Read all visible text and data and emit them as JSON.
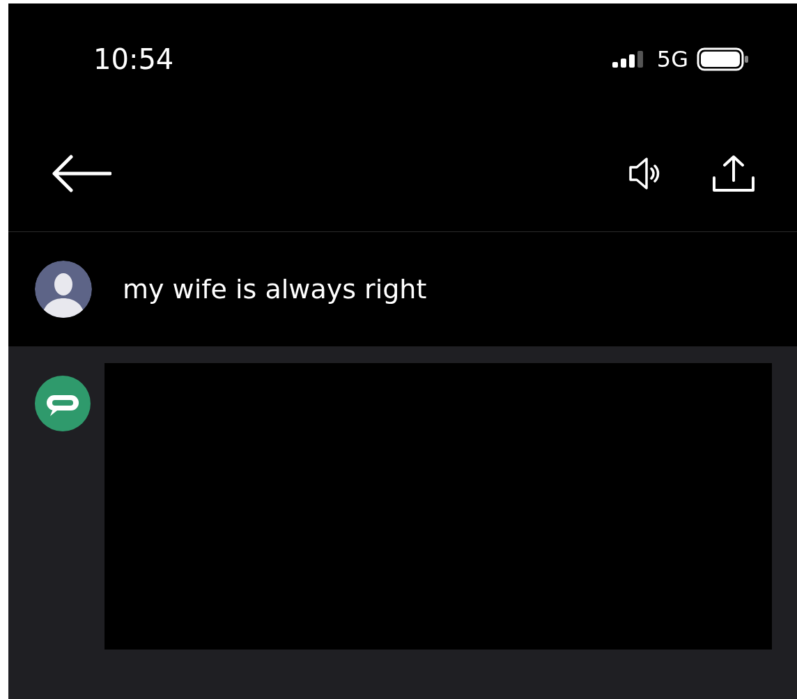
{
  "status_bar": {
    "time": "10:54",
    "network": "5G"
  },
  "prompt": {
    "text": "my wife is always right"
  },
  "response": {
    "kind": "redacted"
  }
}
